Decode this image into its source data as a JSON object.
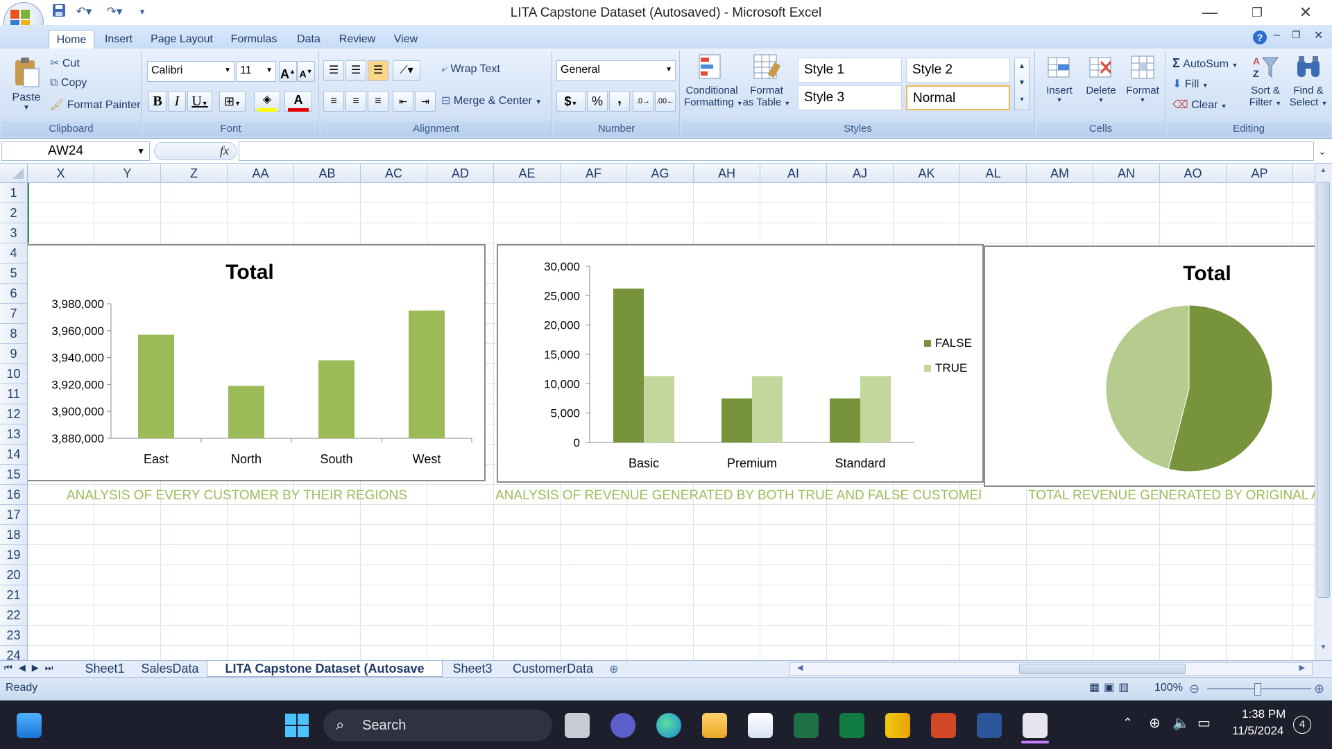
{
  "window": {
    "title": "LITA Capstone Dataset (Autosaved) - Microsoft Excel"
  },
  "ribbon": {
    "tabs": [
      "Home",
      "Insert",
      "Page Layout",
      "Formulas",
      "Data",
      "Review",
      "View"
    ],
    "active_tab": "Home",
    "clipboard": {
      "paste": "Paste",
      "cut": "Cut",
      "copy": "Copy",
      "format_painter": "Format Painter",
      "label": "Clipboard"
    },
    "font": {
      "name": "Calibri",
      "size": "11",
      "label": "Font"
    },
    "alignment": {
      "wrap_text": "Wrap Text",
      "merge_center": "Merge & Center",
      "label": "Alignment"
    },
    "number": {
      "format": "General",
      "label": "Number",
      "currency": "$",
      "percent": "%",
      "comma": ","
    },
    "styles": {
      "conditional": "Conditional",
      "formatting": "Formatting",
      "format": "Format",
      "as_table": "as Table",
      "style1": "Style 1",
      "style2": "Style 2",
      "style3": "Style 3",
      "normal": "Normal",
      "label": "Styles"
    },
    "cells": {
      "insert": "Insert",
      "delete": "Delete",
      "format": "Format",
      "label": "Cells"
    },
    "editing": {
      "autosum": "AutoSum",
      "fill": "Fill",
      "clear": "Clear",
      "sort": "Sort &",
      "filter": "Filter",
      "find": "Find &",
      "select": "Select",
      "label": "Editing"
    }
  },
  "formula_bar": {
    "name_box": "AW24",
    "fx": "fx",
    "value": ""
  },
  "grid": {
    "columns": [
      "X",
      "Y",
      "Z",
      "AA",
      "AB",
      "AC",
      "AD",
      "AE",
      "AF",
      "AG",
      "AH",
      "AI",
      "AJ",
      "AK",
      "AL",
      "AM",
      "AN",
      "AO",
      "AP"
    ],
    "rows": [
      "1",
      "2",
      "3",
      "4",
      "5",
      "6",
      "7",
      "8",
      "9",
      "10",
      "11",
      "12",
      "13",
      "14",
      "15",
      "16",
      "17",
      "18",
      "19",
      "20",
      "21",
      "22",
      "23",
      "24"
    ]
  },
  "captions": {
    "c1": "ANALYSIS OF EVERY CUSTOMER BY THEIR REGIONS",
    "c2": "ANALYSIS OF REVENUE GENERATED BY BOTH TRUE AND FALSE CUSTOMERS",
    "c3": "TOTAL REVENUE GENERATED BY ORIGINAL AN"
  },
  "chart_data": [
    {
      "type": "bar",
      "title": "Total",
      "categories": [
        "East",
        "North",
        "South",
        "West"
      ],
      "values": [
        3957000,
        3919000,
        3938000,
        3975000
      ],
      "ylim": [
        3880000,
        3980000
      ],
      "yticks": [
        "3,880,000",
        "3,900,000",
        "3,920,000",
        "3,940,000",
        "3,960,000",
        "3,980,000"
      ],
      "color": "#9bbb59"
    },
    {
      "type": "bar",
      "title": "",
      "categories": [
        "Basic",
        "Premium",
        "Standard"
      ],
      "series": [
        {
          "name": "FALSE",
          "values": [
            26200,
            7500,
            7500
          ],
          "color": "#77933c"
        },
        {
          "name": "TRUE",
          "values": [
            11300,
            11300,
            11300
          ],
          "color": "#c3d69b"
        }
      ],
      "ylim": [
        0,
        30000
      ],
      "yticks": [
        "0",
        "5,000",
        "10,000",
        "15,000",
        "20,000",
        "25,000",
        "30,000"
      ],
      "legend": "right"
    },
    {
      "type": "pie",
      "title": "Total",
      "values": [
        0.54,
        0.46
      ],
      "colors": [
        "#77933c",
        "#b5cc8e"
      ]
    }
  ],
  "sheet_tabs": [
    "Sheet1",
    "SalesData",
    "LITA Capstone Dataset (Autosave",
    "Sheet3",
    "CustomerData"
  ],
  "active_sheet": "LITA Capstone Dataset (Autosave",
  "status": {
    "ready": "Ready",
    "zoom": "100%"
  },
  "taskbar": {
    "search": "Search",
    "time": "1:38 PM",
    "date": "11/5/2024",
    "badge": "4"
  }
}
